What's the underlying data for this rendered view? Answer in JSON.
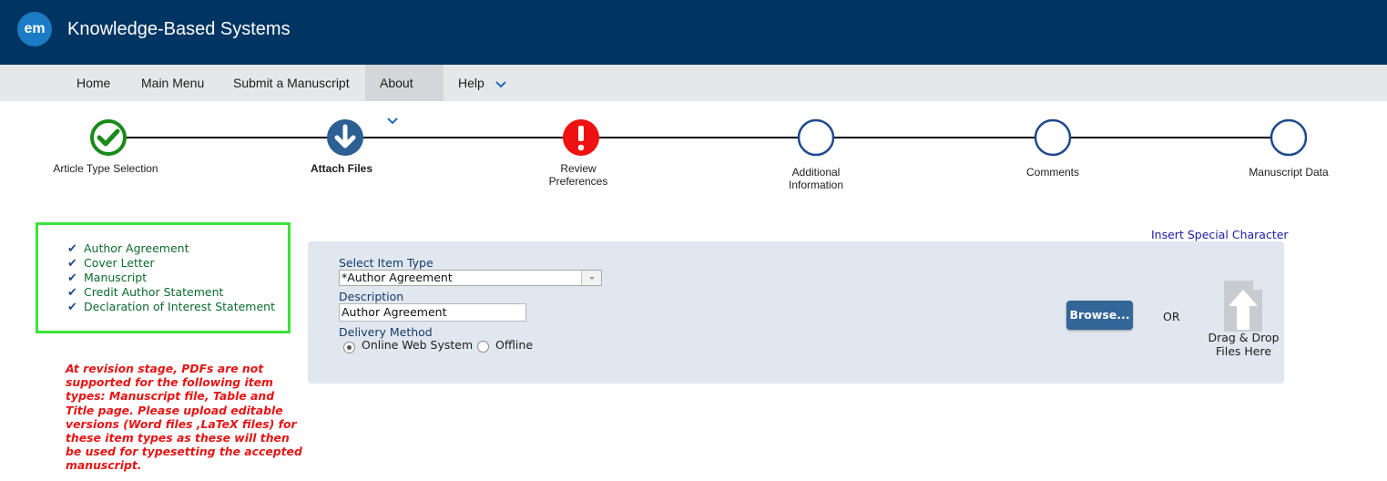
{
  "header": {
    "logo_text": "em",
    "title": "Knowledge-Based Systems",
    "background": "#003462"
  },
  "nav": {
    "items": [
      {
        "label": "Home"
      },
      {
        "label": "Main Menu"
      },
      {
        "label": "Submit a Manuscript"
      },
      {
        "label": "About",
        "dropdown": true
      },
      {
        "label": "Help",
        "dropdown": true
      }
    ]
  },
  "steps": [
    {
      "label": "Article Type Selection",
      "status": "complete",
      "icon": "check-icon",
      "color": "#1a8a1a"
    },
    {
      "label": "Attach Files",
      "status": "current",
      "icon": "arrow-down-icon",
      "color": "#2c5f93"
    },
    {
      "label": "Review Preferences",
      "status": "warning",
      "icon": "exclamation-icon",
      "color": "#ee1111"
    },
    {
      "label": "Additional Information",
      "status": "pending",
      "icon": "empty-circle-icon",
      "color": "#1f4a8c"
    },
    {
      "label": "Comments",
      "status": "pending",
      "icon": "empty-circle-icon",
      "color": "#1f4a8c"
    },
    {
      "label": "Manuscript Data",
      "status": "pending",
      "icon": "empty-circle-icon",
      "color": "#1f4a8c"
    }
  ],
  "checklist": {
    "border_color": "#3ee13a",
    "items": [
      "Author Agreement",
      "Cover Letter",
      "Manuscript",
      "Credit Author Statement",
      "Declaration of Interest Statement"
    ]
  },
  "warning_text": "At revision stage, PDFs are not supported for the following item types: Manuscript file, Table and Title page. Please upload editable versions (Word files ,LaTeX files) for these item types as these will then be used for typesetting the accepted manuscript.",
  "special_char_link": "Insert Special Character",
  "form": {
    "item_type_label": "Select Item Type",
    "item_type_value": "*Author Agreement",
    "description_label": "Description",
    "description_value": "Author Agreement",
    "delivery_label": "Delivery Method",
    "delivery_options": [
      {
        "label": "Online Web System",
        "checked": true
      },
      {
        "label": "Offline",
        "checked": false
      }
    ],
    "browse_label": "Browse...",
    "or_label": "OR",
    "dnd_label": "Drag & Drop Files Here"
  }
}
